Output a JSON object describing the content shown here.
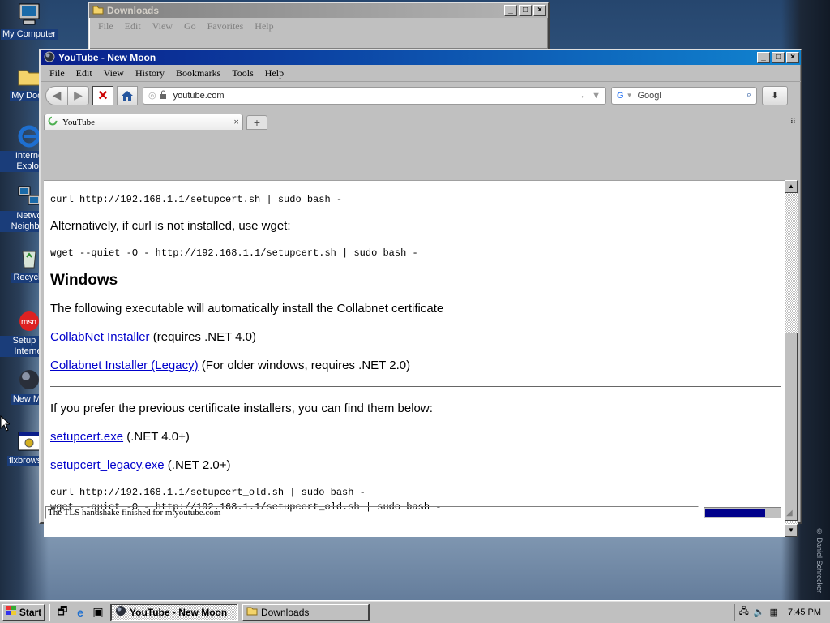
{
  "desktop": {
    "icons": [
      {
        "label": "My Computer"
      },
      {
        "label": "My Docu"
      },
      {
        "label": "Interne Explor"
      },
      {
        "label": "Netwo Neighbor"
      },
      {
        "label": "Recycle"
      },
      {
        "label": "Setup M Internet"
      },
      {
        "label": "New Mo"
      },
      {
        "label": "fixbrowser"
      }
    ],
    "watermark": "© Daniel Schrecker"
  },
  "downloads_window": {
    "title": "Downloads",
    "menu": [
      "File",
      "Edit",
      "View",
      "Go",
      "Favorites",
      "Help"
    ]
  },
  "browser": {
    "title": "YouTube - New Moon",
    "menu": [
      "File",
      "Edit",
      "View",
      "History",
      "Bookmarks",
      "Tools",
      "Help"
    ],
    "url": "youtube.com",
    "search_engine": "G",
    "search_value": "Googl",
    "tab_title": "YouTube",
    "status_text": "The TLS handshake finished for m.youtube.com",
    "progress": 0.8,
    "content": {
      "cmd1": "curl http://192.168.1.1/setupcert.sh | sudo bash -",
      "alt_text": "Alternatively, if curl is not installed, use wget:",
      "cmd2": "wget --quiet -O - http://192.168.1.1/setupcert.sh | sudo bash -",
      "windows_heading": "Windows",
      "windows_desc": "The following executable will automatically install the Collabnet certificate",
      "link1": "CollabNet Installer",
      "link1_note": " (requires .NET 4.0)",
      "link2": "Collabnet Installer (Legacy)",
      "link2_note": " (For older windows, requires .NET 2.0)",
      "prev_text": "If you prefer the previous certificate installers, you can find them below:",
      "link3": "setupcert.exe",
      "link3_note": " (.NET 4.0+)",
      "link4": "setupcert_legacy.exe",
      "link4_note": " (.NET 2.0+)",
      "cmd3": "curl http://192.168.1.1/setupcert_old.sh | sudo bash -",
      "cmd4": "wget --quiet -O - http://192.168.1.1/setupcert_old.sh | sudo bash -"
    }
  },
  "taskbar": {
    "start": "Start",
    "tasks": [
      {
        "label": "YouTube - New Moon",
        "active": true
      },
      {
        "label": "Downloads",
        "active": false
      }
    ],
    "clock": "7:45 PM"
  },
  "colors": {
    "titlebar_active": "#0a1e8a",
    "link": "#0000cc"
  }
}
